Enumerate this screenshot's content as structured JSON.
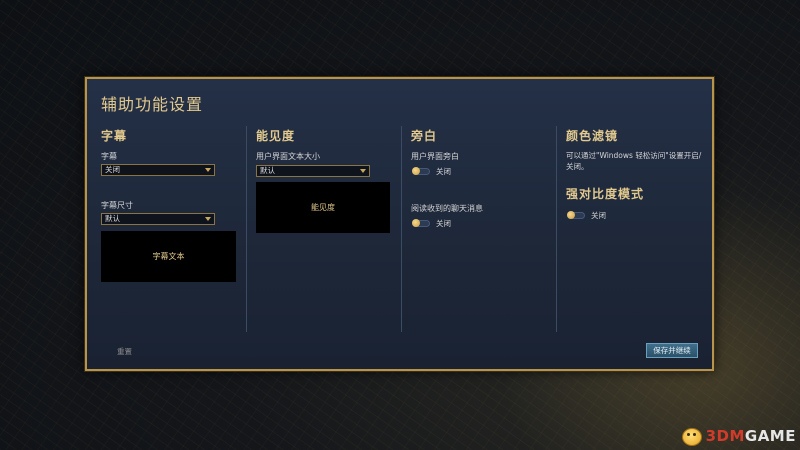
{
  "dialog": {
    "title": "辅助功能设置"
  },
  "subtitles": {
    "section_title": "字幕",
    "subtitle_label": "字幕",
    "subtitle_value": "关闭",
    "size_label": "字幕尺寸",
    "size_value": "默认",
    "preview_text": "字幕文本"
  },
  "visibility": {
    "section_title": "能见度",
    "ui_text_size_label": "用户界面文本大小",
    "ui_text_size_value": "默认",
    "preview_text": "能见度"
  },
  "narration": {
    "section_title": "旁白",
    "ui_narration_label": "用户界面旁白",
    "ui_narration_state": "关闭",
    "chat_read_label": "阅读收到的聊天消息",
    "chat_read_state": "关闭"
  },
  "color_filter": {
    "section_title": "颜色滤镜",
    "description": "可以通过\"Windows 轻松访问\"设置开启/关闭。",
    "high_contrast_title": "强对比度模式",
    "high_contrast_state": "关闭"
  },
  "footer": {
    "reset_label": "重置",
    "save_label": "保存并继续"
  },
  "watermark": {
    "text_a": "3DM",
    "text_b": "GAME"
  },
  "colors": {
    "gold": "#e2c98d",
    "border": "#b8934a",
    "panel": "#1d2738",
    "accent_button": "#3f6f8c"
  }
}
